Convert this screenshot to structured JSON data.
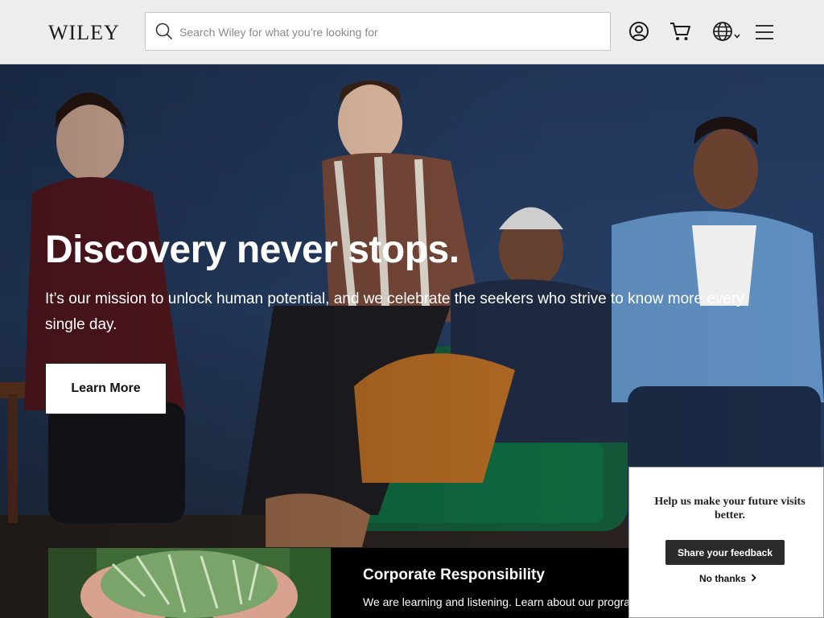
{
  "header": {
    "logo_text": "WILEY",
    "search_placeholder": "Search Wiley for what you’re looking for",
    "icons": [
      "search-icon",
      "account-icon",
      "cart-icon",
      "globe-icon",
      "chevron-down-icon",
      "menu-icon"
    ]
  },
  "hero": {
    "title": "Discovery never stops.",
    "description": "It’s our mission to unlock human potential, and we celebrate the seekers who strive to know more every single day.",
    "button_label": "Learn More"
  },
  "card": {
    "title": "Corporate Responsibility",
    "text": "We are learning and listening. Learn about our progra"
  },
  "feedback": {
    "message": "Help us make your future visits better.",
    "share_label": "Share your feedback",
    "dismiss_label": "No thanks"
  },
  "colors": {
    "header_bg": "#ededed",
    "hero_bg": "#273f66",
    "button_dark": "#2b2b2b"
  }
}
